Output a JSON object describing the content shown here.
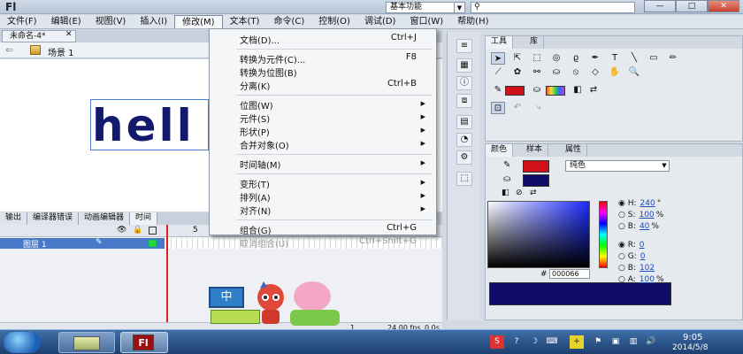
{
  "title_bar": {
    "app_logo": "Fl",
    "workspace": "基本功能",
    "search_placeholder": "",
    "window_buttons": [
      "—",
      "□",
      "✕"
    ]
  },
  "menubar": [
    {
      "label": "文件(F)"
    },
    {
      "label": "编辑(E)"
    },
    {
      "label": "视图(V)"
    },
    {
      "label": "插入(I)"
    },
    {
      "label": "修改(M)",
      "active": true
    },
    {
      "label": "文本(T)"
    },
    {
      "label": "命令(C)"
    },
    {
      "label": "控制(O)"
    },
    {
      "label": "调试(D)"
    },
    {
      "label": "窗口(W)"
    },
    {
      "label": "帮助(H)"
    }
  ],
  "document": {
    "tab_label": "未命名-4*",
    "tab_close": "✕",
    "scene_label": "场景 1",
    "stage_text": "hell"
  },
  "modify_menu": {
    "items": [
      {
        "label": "文档(D)...",
        "shortcut": "Ctrl+J"
      },
      {
        "sep": true
      },
      {
        "label": "转换为元件(C)...",
        "shortcut": "F8"
      },
      {
        "label": "转换为位图(B)",
        "shortcut": ""
      },
      {
        "label": "分离(K)",
        "shortcut": "Ctrl+B"
      },
      {
        "sep": true
      },
      {
        "label": "位图(W)",
        "submenu": true
      },
      {
        "label": "元件(S)",
        "submenu": true
      },
      {
        "label": "形状(P)",
        "submenu": true
      },
      {
        "label": "合并对象(O)",
        "submenu": true
      },
      {
        "sep": true
      },
      {
        "label": "时间轴(M)",
        "submenu": true
      },
      {
        "sep": true
      },
      {
        "label": "变形(T)",
        "submenu": true
      },
      {
        "label": "排列(A)",
        "submenu": true
      },
      {
        "label": "对齐(N)",
        "submenu": true
      },
      {
        "sep": true
      },
      {
        "label": "组合(G)",
        "shortcut": "Ctrl+G"
      },
      {
        "label": "取消组合(U)",
        "shortcut": "Ctrl+Shift+G",
        "disabled": true
      }
    ]
  },
  "bottom_panel": {
    "tabs": [
      "输出",
      "编译器错误",
      "动画编辑器",
      "时间"
    ],
    "layer_name": "图层 1",
    "frame_marker": "5",
    "fps": "24.00 fps",
    "time": "0.0s",
    "frame_counter": "1"
  },
  "tools_panel": {
    "tabs": [
      "工具",
      "库"
    ]
  },
  "color_panel": {
    "tabs": [
      "颜色",
      "样本",
      "属性"
    ],
    "fill_type": "纯色",
    "stroke_color": "#d0111a",
    "fill_color": "#0e0c66",
    "hsb": [
      {
        "key": "H:",
        "value": "240",
        "unit": "°"
      },
      {
        "key": "S:",
        "value": "100",
        "unit": "%"
      },
      {
        "key": "B:",
        "value": "40",
        "unit": "%"
      }
    ],
    "rgb": [
      {
        "key": "R:",
        "value": "0",
        "unit": ""
      },
      {
        "key": "G:",
        "value": "0",
        "unit": ""
      },
      {
        "key": "B:",
        "value": "102",
        "unit": ""
      },
      {
        "key": "A:",
        "value": "100",
        "unit": "%"
      }
    ],
    "hex_prefix": "#",
    "hex": "000066"
  },
  "mascot": {
    "bubble_text": "中"
  },
  "taskbar": {
    "time": "9:05",
    "date": "2014/5/8",
    "flash_label": "Fl"
  }
}
